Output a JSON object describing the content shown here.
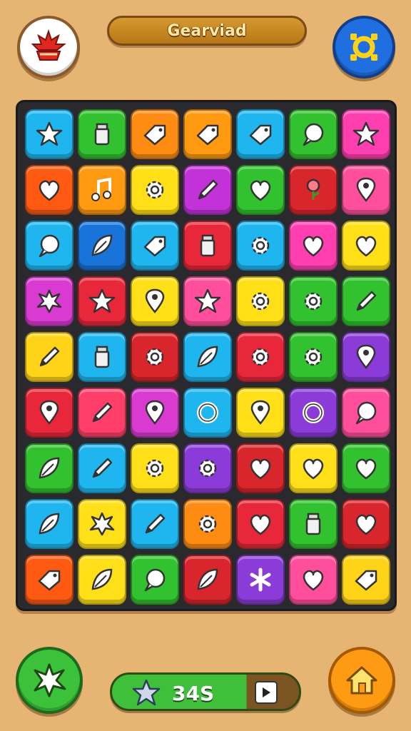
{
  "header": {
    "title": "Gearviad",
    "menu_icon": "red-leaf-emblem-icon",
    "settings_icon": "gear-ring-icon"
  },
  "board": {
    "rows": 9,
    "cols": 7,
    "tiles": [
      [
        {
          "color": "#1fb6f0",
          "icon": "star"
        },
        {
          "color": "#33c22f",
          "icon": "jar"
        },
        {
          "color": "#ff8c12",
          "icon": "tag"
        },
        {
          "color": "#ff9a10",
          "icon": "tag"
        },
        {
          "color": "#1fb6f0",
          "icon": "tag"
        },
        {
          "color": "#33c22f",
          "icon": "bubble"
        },
        {
          "color": "#ff3fb0",
          "icon": "star"
        }
      ],
      [
        {
          "color": "#ff5a12",
          "icon": "heart"
        },
        {
          "color": "#ff9a10",
          "icon": "note"
        },
        {
          "color": "#ffe018",
          "icon": "gear"
        },
        {
          "color": "#c331d8",
          "icon": "pencil"
        },
        {
          "color": "#33c22f",
          "icon": "heart"
        },
        {
          "color": "#d9262c",
          "icon": "rose"
        },
        {
          "color": "#ff4f9c",
          "icon": "pin"
        }
      ],
      [
        {
          "color": "#1fb6f0",
          "icon": "bubble"
        },
        {
          "color": "#1874d8",
          "icon": "leaf"
        },
        {
          "color": "#1fb6f0",
          "icon": "tag"
        },
        {
          "color": "#e8283a",
          "icon": "jar"
        },
        {
          "color": "#1fb6f0",
          "icon": "gear"
        },
        {
          "color": "#ff3fb0",
          "icon": "heart"
        },
        {
          "color": "#ffe018",
          "icon": "heart"
        }
      ],
      [
        {
          "color": "#d93bd0",
          "icon": "splat"
        },
        {
          "color": "#e8283a",
          "icon": "star"
        },
        {
          "color": "#ffe018",
          "icon": "pin"
        },
        {
          "color": "#ff4f9c",
          "icon": "star"
        },
        {
          "color": "#ffe018",
          "icon": "gear"
        },
        {
          "color": "#33c22f",
          "icon": "gear"
        },
        {
          "color": "#33c22f",
          "icon": "pencil"
        }
      ],
      [
        {
          "color": "#ffd418",
          "icon": "pencil"
        },
        {
          "color": "#1fb6f0",
          "icon": "jar"
        },
        {
          "color": "#d9262c",
          "icon": "gear"
        },
        {
          "color": "#1fb6f0",
          "icon": "leaf"
        },
        {
          "color": "#e8283a",
          "icon": "gear"
        },
        {
          "color": "#33c22f",
          "icon": "gear"
        },
        {
          "color": "#8a3bd8",
          "icon": "pin"
        }
      ],
      [
        {
          "color": "#e8283a",
          "icon": "pin"
        },
        {
          "color": "#ff3f6a",
          "icon": "pencil"
        },
        {
          "color": "#d93bd0",
          "icon": "pin"
        },
        {
          "color": "#1fb6f0",
          "icon": "ring"
        },
        {
          "color": "#ffe018",
          "icon": "pin"
        },
        {
          "color": "#8a3bd8",
          "icon": "ring"
        },
        {
          "color": "#ff4f9c",
          "icon": "bubble"
        }
      ],
      [
        {
          "color": "#33c22f",
          "icon": "leaf"
        },
        {
          "color": "#1fb6f0",
          "icon": "pencil"
        },
        {
          "color": "#ffe018",
          "icon": "gear"
        },
        {
          "color": "#8a3bd8",
          "icon": "gear"
        },
        {
          "color": "#d9262c",
          "icon": "heart"
        },
        {
          "color": "#ffe018",
          "icon": "heart"
        },
        {
          "color": "#33c22f",
          "icon": "heart"
        }
      ],
      [
        {
          "color": "#1fb6f0",
          "icon": "leaf"
        },
        {
          "color": "#ffe018",
          "icon": "splat"
        },
        {
          "color": "#1fb6f0",
          "icon": "pencil"
        },
        {
          "color": "#ff8c12",
          "icon": "gear"
        },
        {
          "color": "#e8283a",
          "icon": "heart"
        },
        {
          "color": "#33c22f",
          "icon": "jar"
        },
        {
          "color": "#d9262c",
          "icon": "heart"
        }
      ],
      [
        {
          "color": "#ff5a12",
          "icon": "tag"
        },
        {
          "color": "#ffe018",
          "icon": "leaf"
        },
        {
          "color": "#33c22f",
          "icon": "bubble"
        },
        {
          "color": "#d9262c",
          "icon": "leaf"
        },
        {
          "color": "#8a3bd8",
          "icon": "asterisk"
        },
        {
          "color": "#ff4f9c",
          "icon": "heart"
        },
        {
          "color": "#ffd418",
          "icon": "tag"
        }
      ]
    ]
  },
  "footer": {
    "score": "34S",
    "booster_icon": "splat-star-icon",
    "home_icon": "home-icon",
    "play_icon": "play-icon"
  }
}
